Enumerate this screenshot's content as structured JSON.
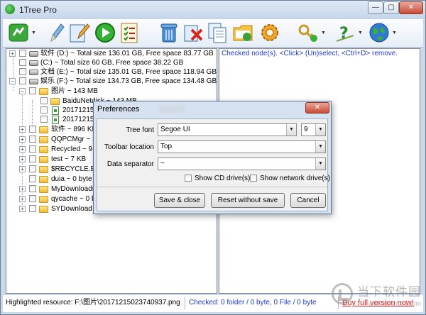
{
  "window": {
    "title": "1Tree Pro",
    "controls": {
      "minimize": "—",
      "maximize": "▢",
      "close": "✕"
    }
  },
  "toolbar": {
    "icons": [
      "refresh-tree-icon",
      "pencil-icon",
      "edit-note-icon",
      "play-icon",
      "checklist-icon",
      "trash-icon",
      "delete-icon",
      "copy-icon",
      "folder-icon",
      "settings-gear-icon",
      "keys-icon",
      "help-icon",
      "globe-icon"
    ]
  },
  "tree": {
    "rows": [
      {
        "label": "软件 (D:) ~ Total size 136.01 GB, Free space 83.77 GB",
        "kind": "drive"
      },
      {
        "label": "(C:) ~ Total size 60 GB, Free space 38.22 GB",
        "kind": "drive"
      },
      {
        "label": "文档 (E:) ~ Total size 135.01 GB, Free space 118.94 GB",
        "kind": "drive"
      },
      {
        "label": "娱乐 (F:) ~ Total size 134.73 GB, Free space 134.48 GB",
        "kind": "drive"
      },
      {
        "label": "图片 ~ 143 MB",
        "kind": "folder"
      },
      {
        "label": "BaiduNetdisk ~ 143 MB",
        "kind": "folder"
      },
      {
        "label": "201712150",
        "kind": "file"
      },
      {
        "label": "201712150",
        "kind": "file"
      },
      {
        "label": "软件 ~ 896 KB",
        "kind": "folder"
      },
      {
        "label": "QQPCMgr ~ 3",
        "kind": "folder"
      },
      {
        "label": "Recycled ~ 9 K",
        "kind": "folder"
      },
      {
        "label": "test ~ 7 KB",
        "kind": "folder"
      },
      {
        "label": "$RECYCLE.BIN",
        "kind": "folder"
      },
      {
        "label": "duia ~ 0 byte",
        "kind": "folder"
      },
      {
        "label": "MyDownloads",
        "kind": "folder"
      },
      {
        "label": "qycache ~ 0 b",
        "kind": "folder"
      },
      {
        "label": "SYDownload ~",
        "kind": "folder"
      }
    ]
  },
  "right_pane": {
    "hint": "Checked node(s). <Click> (Un)select, <Ctrl+D> remove."
  },
  "status": {
    "highlighted": "Highlighted resource: F:\\图片\\20171215023740937.png",
    "checked": "Checked:  0 folder / 0  byte, 0 File / 0  byte",
    "promo": "Buy full version now!"
  },
  "dialog": {
    "title": "Preferences",
    "close_label": "✕",
    "tree_font_label": "Tree font",
    "tree_font_value": "Segoe UI",
    "font_size_value": "9",
    "toolbar_location_label": "Toolbar location",
    "toolbar_location_value": "Top",
    "data_separator_label": "Data separator",
    "data_separator_value": "~",
    "show_cd_label": "Show CD drive(s)",
    "show_network_label": "Show network drive(s)",
    "save_close_label": "Save & close",
    "reset_label": "Reset without save",
    "cancel_label": "Cancel",
    "dropdown_arrow": "▼"
  },
  "watermark": {
    "text": "当下软件园",
    "url": "www.downxia.com"
  },
  "colors": {
    "accent_blue": "#1f3ad0",
    "promo_red": "#e02020",
    "frame": "#c9d9ea"
  }
}
